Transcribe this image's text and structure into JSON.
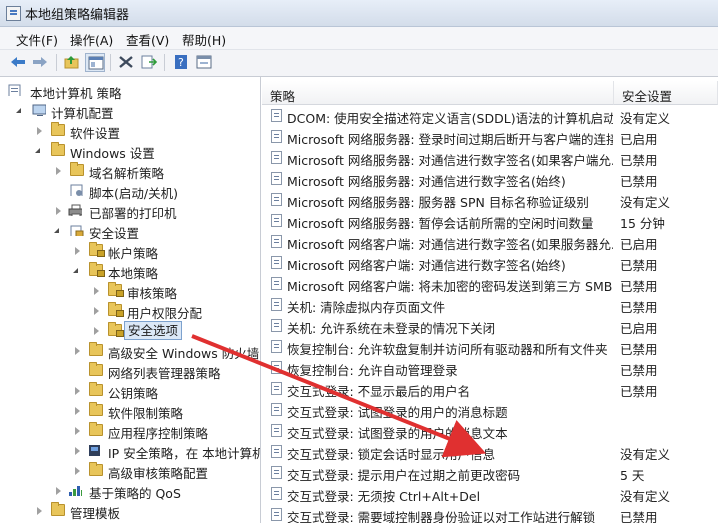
{
  "window": {
    "title": "本地组策略编辑器"
  },
  "menu": [
    "文件(F)",
    "操作(A)",
    "查看(V)",
    "帮助(H)"
  ],
  "toolbar": {
    "buttons": [
      "back-arrow-icon",
      "forward-arrow-icon",
      "up-folder-icon",
      "show-hide-tree-icon",
      "delete-icon",
      "export-list-icon",
      "help-icon",
      "properties-icon"
    ]
  },
  "tree": [
    {
      "label": "本地计算机 策略",
      "icon": "computer-policy-icon"
    },
    {
      "label": "计算机配置",
      "icon": "computer-icon"
    },
    {
      "label": "软件设置",
      "icon": "folder-icon"
    },
    {
      "label": "Windows 设置",
      "icon": "folder-icon"
    },
    {
      "label": "域名解析策略",
      "icon": "folder-icon"
    },
    {
      "label": "脚本(启动/关机)",
      "icon": "script-icon"
    },
    {
      "label": "已部署的打印机",
      "icon": "printer-icon"
    },
    {
      "label": "安全设置",
      "icon": "security-icon"
    },
    {
      "label": "帐户策略",
      "icon": "folder-icon"
    },
    {
      "label": "本地策略",
      "icon": "folder-icon"
    },
    {
      "label": "审核策略",
      "icon": "folder-icon"
    },
    {
      "label": "用户权限分配",
      "icon": "folder-icon"
    },
    {
      "label": "安全选项",
      "icon": "folder-icon"
    },
    {
      "label": "高级安全 Windows 防火墙",
      "icon": "folder-icon"
    },
    {
      "label": "网络列表管理器策略",
      "icon": "folder-icon"
    },
    {
      "label": "公钥策略",
      "icon": "folder-icon"
    },
    {
      "label": "软件限制策略",
      "icon": "folder-icon"
    },
    {
      "label": "应用程序控制策略",
      "icon": "folder-icon"
    },
    {
      "label": "IP 安全策略，在 本地计算机",
      "icon": "ip-security-icon"
    },
    {
      "label": "高级审核策略配置",
      "icon": "folder-icon"
    },
    {
      "label": "基于策略的 QoS",
      "icon": "qos-chart-icon"
    },
    {
      "label": "管理模板",
      "icon": "folder-icon"
    }
  ],
  "columns": {
    "policy": "策略",
    "setting": "安全设置"
  },
  "policies": [
    {
      "name": "DCOM: 使用安全描述符定义语言(SDDL)语法的计算机启动...",
      "value": "没有定义"
    },
    {
      "name": "Microsoft 网络服务器: 登录时间过期后断开与客户端的连接",
      "value": "已启用"
    },
    {
      "name": "Microsoft 网络服务器: 对通信进行数字签名(如果客户端允...",
      "value": "已禁用"
    },
    {
      "name": "Microsoft 网络服务器: 对通信进行数字签名(始终)",
      "value": "已禁用"
    },
    {
      "name": "Microsoft 网络服务器: 服务器 SPN 目标名称验证级别",
      "value": "没有定义"
    },
    {
      "name": "Microsoft 网络服务器: 暂停会话前所需的空闲时间数量",
      "value": "15 分钟"
    },
    {
      "name": "Microsoft 网络客户端: 对通信进行数字签名(如果服务器允...",
      "value": "已启用"
    },
    {
      "name": "Microsoft 网络客户端: 对通信进行数字签名(始终)",
      "value": "已禁用"
    },
    {
      "name": "Microsoft 网络客户端: 将未加密的密码发送到第三方 SMB...",
      "value": "已禁用"
    },
    {
      "name": "关机: 清除虚拟内存页面文件",
      "value": "已禁用"
    },
    {
      "name": "关机: 允许系统在未登录的情况下关闭",
      "value": "已启用"
    },
    {
      "name": "恢复控制台: 允许软盘复制并访问所有驱动器和所有文件夹",
      "value": "已禁用"
    },
    {
      "name": "恢复控制台: 允许自动管理登录",
      "value": "已禁用"
    },
    {
      "name": "交互式登录: 不显示最后的用户名",
      "value": "已禁用"
    },
    {
      "name": "交互式登录: 试图登录的用户的消息标题",
      "value": ""
    },
    {
      "name": "交互式登录: 试图登录的用户的消息文本",
      "value": ""
    },
    {
      "name": "交互式登录: 锁定会话时显示用户信息",
      "value": "没有定义"
    },
    {
      "name": "交互式登录: 提示用户在过期之前更改密码",
      "value": "5 天"
    },
    {
      "name": "交互式登录: 无须按 Ctrl+Alt+Del",
      "value": "没有定义"
    },
    {
      "name": "交互式登录: 需要域控制器身份验证以对工作站进行解锁",
      "value": "已禁用"
    }
  ],
  "annotation": {
    "color": "#e03030"
  },
  "colors": {
    "selection": "#dbe8f7",
    "folder": "#e8c55a"
  }
}
